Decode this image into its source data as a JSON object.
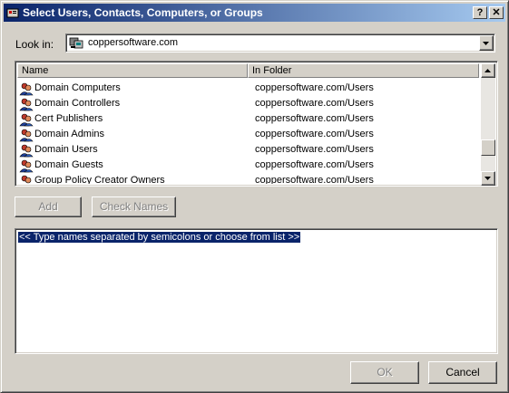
{
  "window": {
    "title": "Select Users, Contacts, Computers, or Groups",
    "help_label": "?",
    "close_label": "✕"
  },
  "lookin": {
    "label": "Look in:",
    "value": "coppersoftware.com"
  },
  "list": {
    "headers": {
      "name": "Name",
      "folder": "In Folder"
    },
    "rows": [
      {
        "name": "Domain Computers",
        "folder": "coppersoftware.com/Users"
      },
      {
        "name": "Domain Controllers",
        "folder": "coppersoftware.com/Users"
      },
      {
        "name": "Cert Publishers",
        "folder": "coppersoftware.com/Users"
      },
      {
        "name": "Domain Admins",
        "folder": "coppersoftware.com/Users"
      },
      {
        "name": "Domain Users",
        "folder": "coppersoftware.com/Users"
      },
      {
        "name": "Domain Guests",
        "folder": "coppersoftware.com/Users"
      },
      {
        "name": "Group Policy Creator Owners",
        "folder": "coppersoftware.com/Users"
      }
    ]
  },
  "buttons": {
    "add": "Add",
    "check_names": "Check Names",
    "ok": "OK",
    "cancel": "Cancel"
  },
  "names_field": {
    "hint": "<< Type names separated by semicolons or choose from list >>"
  },
  "icons": {
    "group": "group-icon",
    "domain": "domain-icon"
  }
}
